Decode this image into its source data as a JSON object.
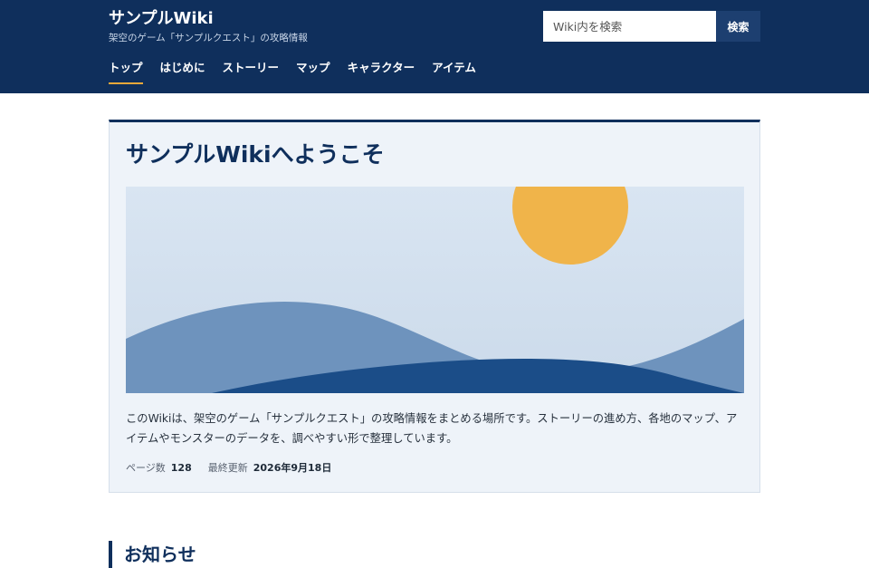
{
  "site": {
    "title": "サンプルWiki",
    "subtitle": "架空のゲーム「サンプルクエスト」の攻略情報"
  },
  "search": {
    "placeholder": "Wiki内を検索",
    "button_label": "検索"
  },
  "nav": {
    "items": [
      {
        "label": "トップ",
        "active": true
      },
      {
        "label": "はじめに"
      },
      {
        "label": "ストーリー"
      },
      {
        "label": "マップ"
      },
      {
        "label": "キャラクター"
      },
      {
        "label": "アイテム"
      }
    ]
  },
  "welcome": {
    "title": "サンプルWikiへようこそ",
    "intro": "このWikiは、架空のゲーム「サンプルクエスト」の攻略情報をまとめる場所です。ストーリーの進め方、各地のマップ、アイテムやモンスターのデータを、調べやすい形で整理しています。",
    "meta": {
      "pages_label": "ページ数",
      "pages_value": "128",
      "updated_label": "最終更新",
      "updated_value": "2026年9月18日"
    }
  },
  "news": {
    "heading": "お知らせ"
  },
  "colors": {
    "header_bg": "#0f2f5c",
    "accent": "#e8a83a",
    "sun": "#f0b44a",
    "sky": "#d6e3f1",
    "hill_back": "#6e93bd",
    "hill_front": "#1b4d88"
  }
}
